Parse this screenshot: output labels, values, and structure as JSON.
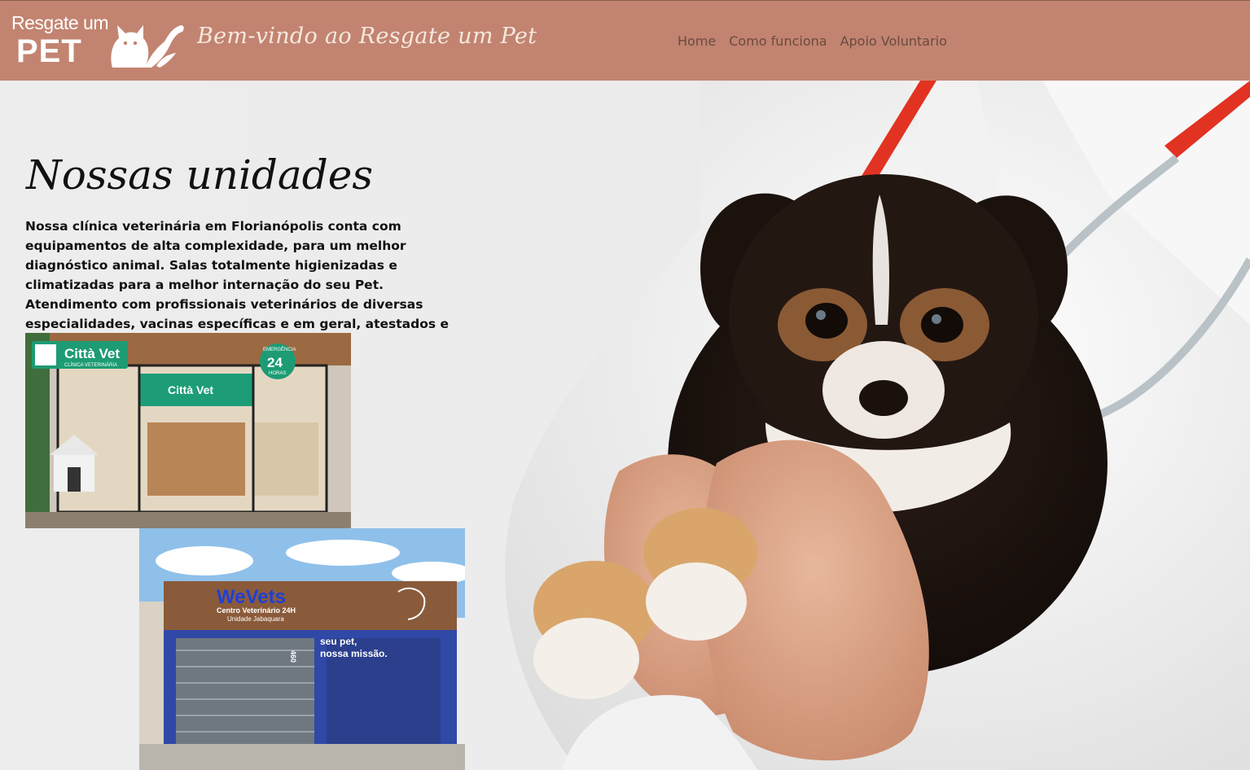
{
  "header": {
    "logo_top": "Resgate um",
    "logo_bottom": "PET",
    "welcome": "Bem-vindo ao Resgate um Pet",
    "nav": [
      "Home",
      "Como funciona",
      "Apoio Voluntario"
    ]
  },
  "main": {
    "title": "Nossas unidades",
    "description": "Nossa clínica veterinária em Florianópolis conta com equipamentos de alta complexidade, para um melhor diagnóstico animal. Salas totalmente higienizadas e climatizadas para a melhor internação do seu Pet. Atendimento com profissionais veterinários de diversas especialidades, vacinas específicas e em geral, atestados e muito mais..."
  },
  "clinic1": {
    "brand": "Città Vet",
    "subtitle": "CLÍNICA VETERINÁRIA",
    "badge_top": "EMERGÊNCIA",
    "badge_number": "24",
    "badge_bottom": "HORAS"
  },
  "clinic2": {
    "brand": "WeVets",
    "line1": "Centro Veterinário 24H",
    "line2": "Unidade Jabaquara",
    "slogan1": "seu pet,",
    "slogan2": "nossa missão.",
    "number": "460"
  },
  "colors": {
    "header_bg": "#c28470",
    "page_bg": "#ececec",
    "text": "#111111",
    "nav_text": "#6a4a40"
  },
  "icons": [
    "cat-dog-logo-icon"
  ]
}
